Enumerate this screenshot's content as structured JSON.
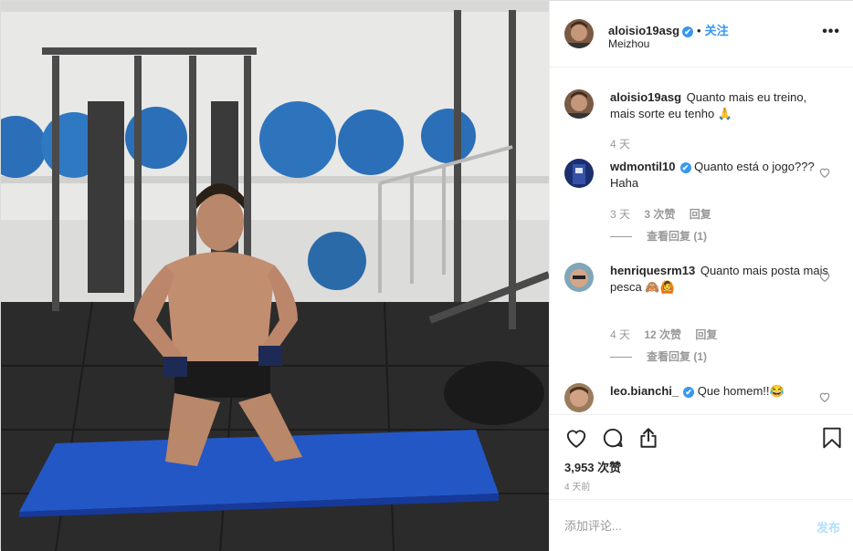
{
  "post": {
    "username": "aloisio19asg",
    "follow_label": "关注",
    "location": "Meizhou",
    "more_label": "•••",
    "verified_mark": "✔"
  },
  "caption": {
    "username": "aloisio19asg",
    "text": "Quanto mais eu treino, mais sorte eu tenho 🙏",
    "time": "4 天"
  },
  "comments": [
    {
      "username": "wdmontil10",
      "verified": true,
      "text": "Quanto está o jogo??? Haha",
      "time": "3 天",
      "likes": "3 次赞",
      "reply_label": "回复",
      "view_replies": "查看回复 (1)"
    },
    {
      "username": "henriquesrm13",
      "verified": false,
      "text": "Quanto mais posta mais pesca 🙈🙆",
      "time": "4 天",
      "likes": "12 次赞",
      "reply_label": "回复",
      "view_replies": "查看回复 (1)"
    },
    {
      "username": "leo.bianchi_",
      "verified": true,
      "text": "Que homem!!😂",
      "time": "",
      "likes": "",
      "reply_label": "",
      "view_replies": ""
    }
  ],
  "actions": {
    "like_icon": "heart-icon",
    "comment_icon": "comment-bubble-icon",
    "share_icon": "share-icon",
    "save_icon": "bookmark-icon"
  },
  "stats": {
    "likes": "3,953 次赞",
    "posted_ago": "4 天前"
  },
  "add_comment": {
    "placeholder": "添加评论...",
    "post_label": "发布"
  },
  "colors": {
    "accent": "#3897f0",
    "muted": "#999999",
    "border": "#efefef",
    "post_disabled": "#b2dffc"
  }
}
